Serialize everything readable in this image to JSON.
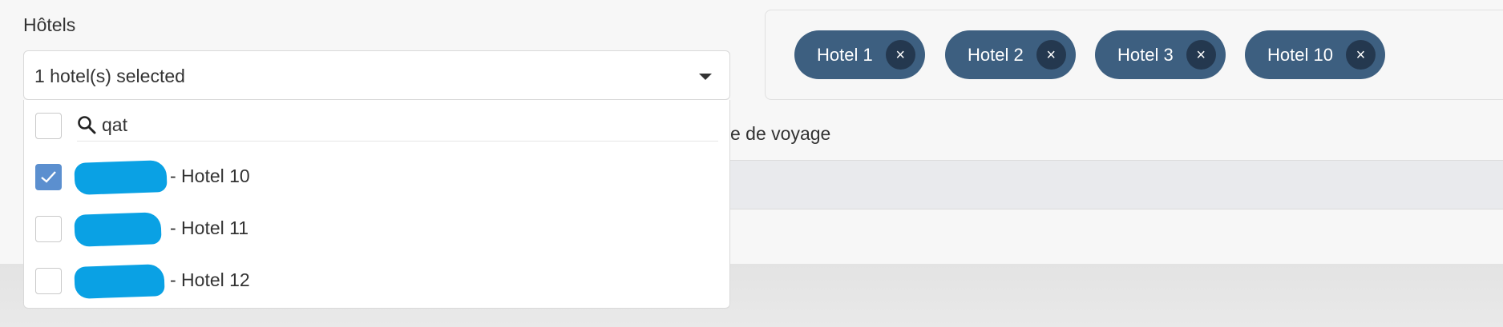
{
  "hotels_field": {
    "label": "Hôtels",
    "selected_text": "1 hotel(s) selected"
  },
  "search": {
    "value": "qat"
  },
  "options": [
    {
      "label": "- Hotel 10",
      "checked": true
    },
    {
      "label": "- Hotel 11",
      "checked": false
    },
    {
      "label": "- Hotel 12",
      "checked": false
    }
  ],
  "chips": [
    {
      "label": "Hotel 1",
      "remove": "×"
    },
    {
      "label": "Hotel 2",
      "remove": "×"
    },
    {
      "label": "Hotel 3",
      "remove": "×"
    },
    {
      "label": "Hotel 10",
      "remove": "×"
    }
  ],
  "background": {
    "partial_text": "e de voyage"
  },
  "colors": {
    "chip_bg": "#3d5f80",
    "chip_remove_bg": "#24384f",
    "checkbox_checked": "#5b8fcf",
    "redaction": "#0aa1e4"
  },
  "icons": {
    "search": "search-icon",
    "caret": "caret-down-icon",
    "check": "check-icon",
    "remove": "close-icon"
  }
}
